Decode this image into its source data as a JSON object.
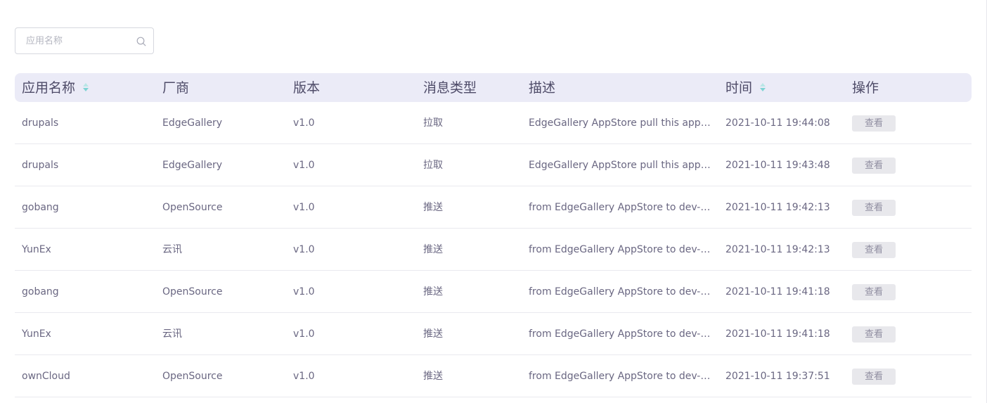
{
  "search": {
    "placeholder": "应用名称"
  },
  "table": {
    "headers": {
      "app_name": "应用名称",
      "vendor": "厂商",
      "version": "版本",
      "message_type": "消息类型",
      "description": "描述",
      "time": "时间",
      "actions": "操作"
    },
    "rows": [
      {
        "app_name": "drupals",
        "vendor": "EdgeGallery",
        "version": "v1.0",
        "message_type": "拉取",
        "description": "EdgeGallery AppStore pull this app fro…",
        "time": "2021-10-11 19:44:08",
        "action_label": "查看"
      },
      {
        "app_name": "drupals",
        "vendor": "EdgeGallery",
        "version": "v1.0",
        "message_type": "拉取",
        "description": "EdgeGallery AppStore pull this app fro…",
        "time": "2021-10-11 19:43:48",
        "action_label": "查看"
      },
      {
        "app_name": "gobang",
        "vendor": "OpenSource",
        "version": "v1.0",
        "message_type": "推送",
        "description": "from EdgeGallery AppStore to dev-en…",
        "time": "2021-10-11 19:42:13",
        "action_label": "查看"
      },
      {
        "app_name": "YunEx",
        "vendor": "云讯",
        "version": "v1.0",
        "message_type": "推送",
        "description": "from EdgeGallery AppStore to dev-en…",
        "time": "2021-10-11 19:42:13",
        "action_label": "查看"
      },
      {
        "app_name": "gobang",
        "vendor": "OpenSource",
        "version": "v1.0",
        "message_type": "推送",
        "description": "from EdgeGallery AppStore to dev-en…",
        "time": "2021-10-11 19:41:18",
        "action_label": "查看"
      },
      {
        "app_name": "YunEx",
        "vendor": "云讯",
        "version": "v1.0",
        "message_type": "推送",
        "description": "from EdgeGallery AppStore to dev-en…",
        "time": "2021-10-11 19:41:18",
        "action_label": "查看"
      },
      {
        "app_name": "ownCloud",
        "vendor": "OpenSource",
        "version": "v1.0",
        "message_type": "推送",
        "description": "from EdgeGallery AppStore to dev-en…",
        "time": "2021-10-11 19:37:51",
        "action_label": "查看"
      }
    ]
  },
  "icons": {
    "search": "search-icon",
    "sort": "sort-icon"
  },
  "colors": {
    "header_bg": "#ebebf7",
    "sort_up": "#b9e6e6",
    "sort_down": "#7fd4d4",
    "button_bg": "#e8e8ec"
  }
}
